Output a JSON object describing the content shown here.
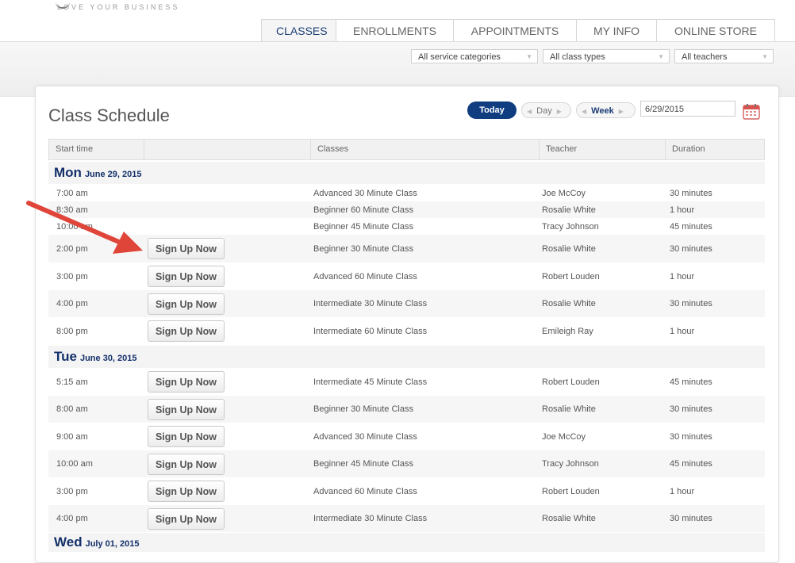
{
  "logo": {
    "tagline": "LOVE YOUR BUSINESS"
  },
  "nav": {
    "tabs": [
      "CLASSES",
      "ENROLLMENTS",
      "APPOINTMENTS",
      "MY INFO",
      "ONLINE STORE"
    ]
  },
  "filters": {
    "service_categories": "All service categories",
    "class_types": "All class types",
    "teachers": "All teachers"
  },
  "schedule": {
    "title": "Class Schedule",
    "today_label": "Today",
    "day_label": "Day",
    "week_label": "Week",
    "date_value": "6/29/2015",
    "columns": [
      "Start time",
      "",
      "Classes",
      "Teacher",
      "Duration"
    ],
    "signup_label": "Sign Up Now",
    "days": [
      {
        "name": "Mon",
        "date": "June 29, 2015"
      },
      {
        "name": "Tue",
        "date": "June 30, 2015"
      },
      {
        "name": "Wed",
        "date": "July 01, 2015"
      }
    ],
    "rows": [
      {
        "time": "7:00 am",
        "class": "Advanced 30 Minute Class",
        "teacher": "Joe McCoy",
        "duration": "30 minutes"
      },
      {
        "time": "8:30 am",
        "class": "Beginner 60 Minute Class",
        "teacher": "Rosalie White",
        "duration": "1 hour"
      },
      {
        "time": "10:00 am",
        "class": "Beginner 45 Minute Class",
        "teacher": "Tracy Johnson",
        "duration": "45 minutes"
      },
      {
        "time": "2:00 pm",
        "class": "Beginner 30 Minute Class",
        "teacher": "Rosalie White",
        "duration": "30 minutes"
      },
      {
        "time": "3:00 pm",
        "class": "Advanced 60 Minute Class",
        "teacher": "Robert Louden",
        "duration": "1 hour"
      },
      {
        "time": "4:00 pm",
        "class": "Intermediate 30 Minute Class",
        "teacher": "Rosalie White",
        "duration": "30 minutes"
      },
      {
        "time": "8:00 pm",
        "class": "Intermediate 60 Minute Class",
        "teacher": "Emileigh Ray",
        "duration": "1 hour"
      },
      {
        "time": "5:15 am",
        "class": "Intermediate 45 Minute Class",
        "teacher": "Robert Louden",
        "duration": "45 minutes"
      },
      {
        "time": "8:00 am",
        "class": "Beginner 30 Minute Class",
        "teacher": "Rosalie White",
        "duration": "30 minutes"
      },
      {
        "time": "9:00 am",
        "class": "Advanced 30 Minute Class",
        "teacher": "Joe McCoy",
        "duration": "30 minutes"
      },
      {
        "time": "10:00 am",
        "class": "Beginner 45 Minute Class",
        "teacher": "Tracy Johnson",
        "duration": "45 minutes"
      },
      {
        "time": "3:00 pm",
        "class": "Advanced 60 Minute Class",
        "teacher": "Robert Louden",
        "duration": "1 hour"
      },
      {
        "time": "4:00 pm",
        "class": "Intermediate 30 Minute Class",
        "teacher": "Rosalie White",
        "duration": "30 minutes"
      }
    ]
  }
}
